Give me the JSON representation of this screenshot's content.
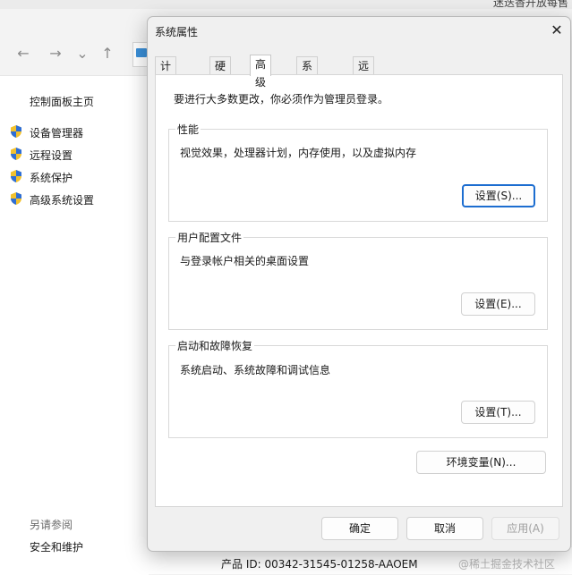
{
  "background": {
    "top_right_text": "迷迭香开放每售",
    "nav": {
      "back": "←",
      "forward": "→",
      "recent": "⌄",
      "up": "↑"
    },
    "left_pane": {
      "home_link": "控制面板主页",
      "items": [
        {
          "label": "设备管理器"
        },
        {
          "label": "远程设置"
        },
        {
          "label": "系统保护"
        },
        {
          "label": "高级系统设置"
        }
      ],
      "see_also_label": "另请参阅",
      "see_also_items": [
        {
          "label": "安全和维护"
        }
      ]
    },
    "product_id": "产品 ID: 00342-31545-01258-AAOEM",
    "watermark": "@稀土掘金技术社区"
  },
  "dialog": {
    "title": "系统属性",
    "close": "✕",
    "tabs": [
      {
        "label": "计算机名"
      },
      {
        "label": "硬件"
      },
      {
        "label": "高级"
      },
      {
        "label": "系统保护"
      },
      {
        "label": "远程"
      }
    ],
    "active_tab": "高级",
    "notice": "要进行大多数更改，你必须作为管理员登录。",
    "performance": {
      "label": "性能",
      "desc": "视觉效果，处理器计划，内存使用，以及虚拟内存",
      "button": "设置(S)..."
    },
    "user_profiles": {
      "label": "用户配置文件",
      "desc": "与登录帐户相关的桌面设置",
      "button": "设置(E)..."
    },
    "startup_recovery": {
      "label": "启动和故障恢复",
      "desc": "系统启动、系统故障和调试信息",
      "button": "设置(T)..."
    },
    "env_button": "环境变量(N)...",
    "footer": {
      "ok": "确定",
      "cancel": "取消",
      "apply": "应用(A)"
    }
  },
  "colors": {
    "accent": "#1c6dd0",
    "shield_blue": "#2f6fd6",
    "shield_yellow": "#f2c12e"
  }
}
